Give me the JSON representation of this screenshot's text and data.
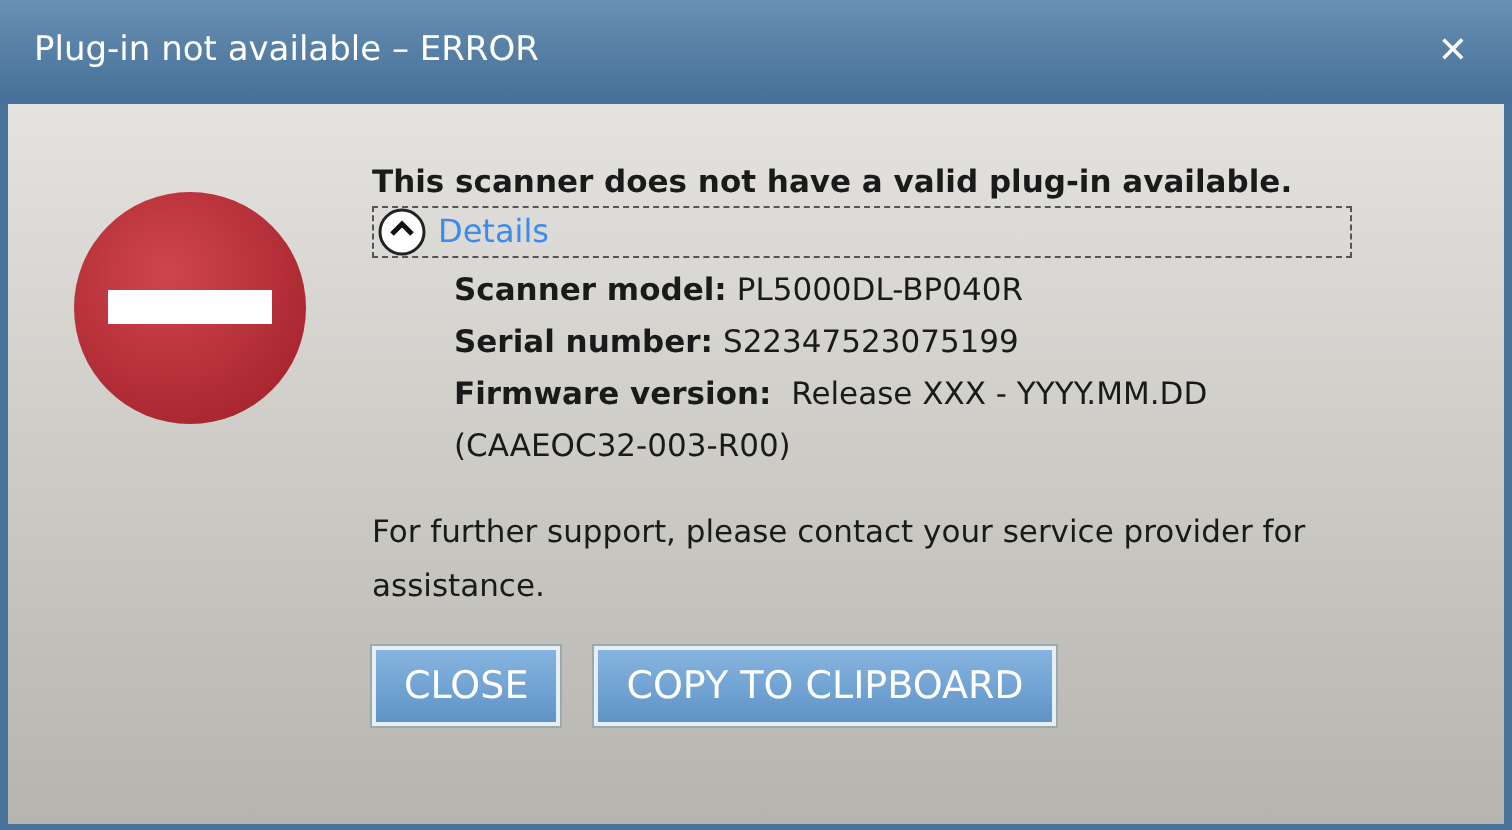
{
  "window": {
    "title": "Plug-in not available – ERROR",
    "close": "✕"
  },
  "message": "This scanner does not have a valid plug-in available.",
  "details": {
    "label": "Details",
    "expanded": true,
    "fields": [
      {
        "label": "Scanner model:",
        "value": "PL5000DL-BP040R"
      },
      {
        "label": "Serial number:",
        "value": "S22347523075199"
      },
      {
        "label": "Firmware version:",
        "value": " Release XXX - YYYY.MM.DD"
      }
    ],
    "extra": "(CAAEOC32-003-R00)"
  },
  "support": "For further support, please contact your service provider for assistance.",
  "buttons": [
    "CLOSE",
    "COPY TO CLIPBOARD"
  ]
}
